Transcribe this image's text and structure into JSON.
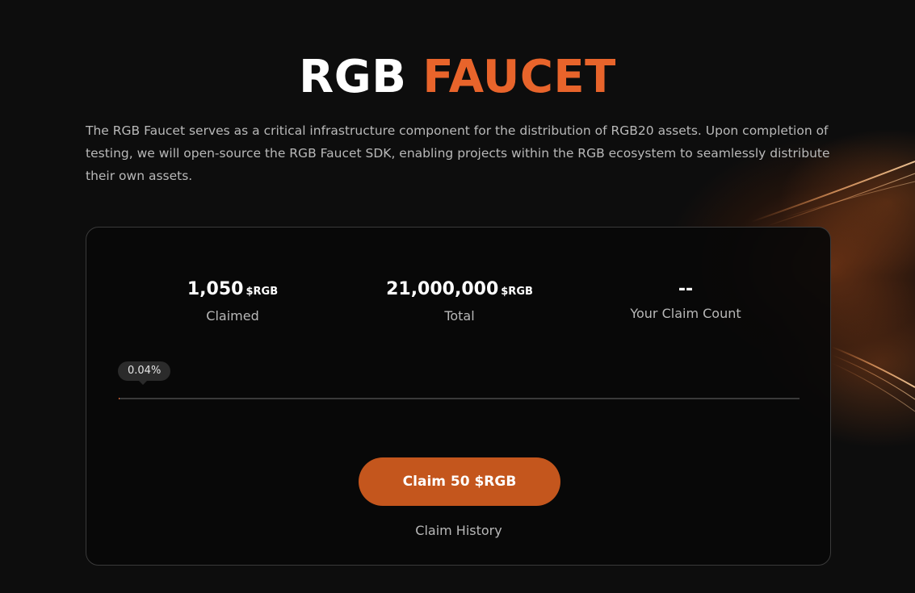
{
  "header": {
    "title_white": "RGB",
    "title_orange": "FAUCET"
  },
  "description": "The RGB Faucet serves as a critical infrastructure component for the distribution of RGB20 assets. Upon completion of testing, we will open-source the RGB Faucet SDK, enabling projects within the RGB ecosystem to seamlessly distribute their own assets.",
  "stats": {
    "claimed": {
      "value": "1,050",
      "unit": "$RGB",
      "label": "Claimed"
    },
    "total": {
      "value": "21,000,000",
      "unit": "$RGB",
      "label": "Total"
    },
    "your_claims": {
      "value": "--",
      "label": "Your Claim Count"
    }
  },
  "progress": {
    "percent_label": "0.04%",
    "fraction": 0.0005
  },
  "actions": {
    "claim_label": "Claim 50 $RGB",
    "history_label": "Claim History"
  },
  "colors": {
    "accent": "#e8642b",
    "button": "#c4561d",
    "background": "#0d0d0d"
  }
}
